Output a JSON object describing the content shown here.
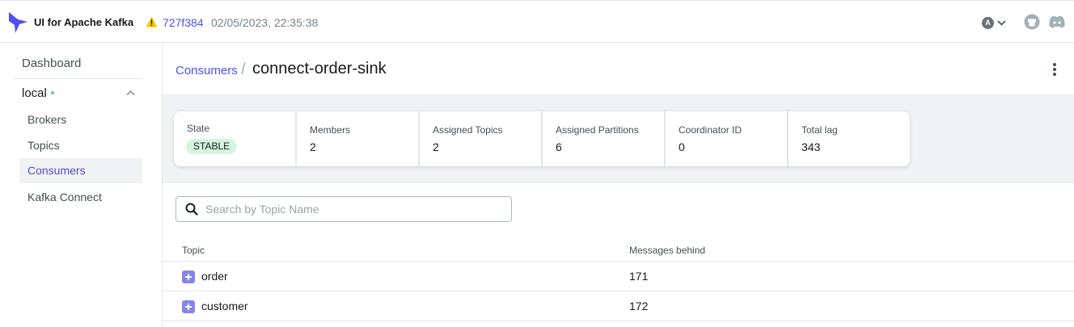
{
  "header": {
    "app_title": "UI for Apache Kafka",
    "commit": "727f384",
    "build_date": "02/05/2023, 22:35:38",
    "avatar_letter": "A"
  },
  "sidebar": {
    "dashboard": "Dashboard",
    "cluster": "local",
    "items": [
      {
        "label": "Brokers"
      },
      {
        "label": "Topics"
      },
      {
        "label": "Consumers"
      },
      {
        "label": "Kafka Connect"
      }
    ]
  },
  "breadcrumb": {
    "parent": "Consumers",
    "separator": "/"
  },
  "page_title": "connect-order-sink",
  "metrics": [
    {
      "label": "State",
      "value": "STABLE"
    },
    {
      "label": "Members",
      "value": "2"
    },
    {
      "label": "Assigned Topics",
      "value": "2"
    },
    {
      "label": "Assigned Partitions",
      "value": "6"
    },
    {
      "label": "Coordinator ID",
      "value": "0"
    },
    {
      "label": "Total lag",
      "value": "343"
    }
  ],
  "search": {
    "placeholder": "Search by Topic Name"
  },
  "table": {
    "headers": [
      "Topic",
      "Messages behind"
    ],
    "rows": [
      {
        "topic": "order",
        "behind": "171"
      },
      {
        "topic": "customer",
        "behind": "172"
      }
    ]
  },
  "colors": {
    "accent": "#4f4ff0",
    "active_nav": "#4c4ccc",
    "stable_badge": "#d6f5e0",
    "expand": "#8585e5"
  }
}
